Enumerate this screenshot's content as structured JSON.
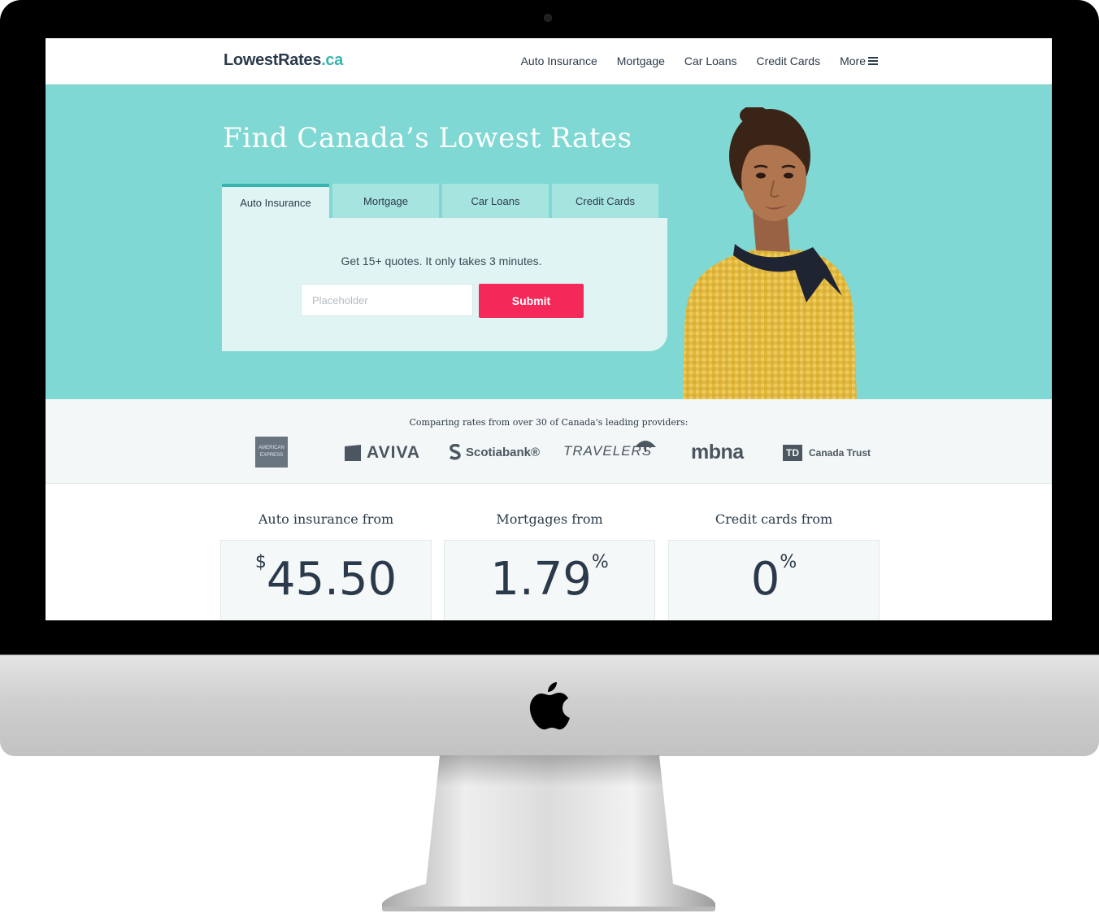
{
  "brand": {
    "name": "LowestRates",
    "tld": ".ca"
  },
  "nav": {
    "items": [
      "Auto Insurance",
      "Mortgage",
      "Car Loans",
      "Credit Cards"
    ],
    "more": "More"
  },
  "hero": {
    "title": "Find Canada’s Lowest Rates",
    "tabs": [
      {
        "label": "Auto Insurance",
        "active": true
      },
      {
        "label": "Mortgage",
        "active": false
      },
      {
        "label": "Car Loans",
        "active": false
      },
      {
        "label": "Credit Cards",
        "active": false
      }
    ],
    "tagline": "Get 15+ quotes. It only takes 3 minutes.",
    "input_placeholder": "Placeholder",
    "submit_label": "Submit"
  },
  "providers": {
    "caption": "Comparing rates from over 30 of Canada's leading providers:",
    "logos": [
      {
        "name": "American Express",
        "mark": "AMERICAN EXPRESS"
      },
      {
        "name": "Aviva",
        "mark": "AVIVA"
      },
      {
        "name": "Scotiabank",
        "mark": "Scotiabank®"
      },
      {
        "name": "Travelers",
        "mark": "TRAVELERS"
      },
      {
        "name": "MBNA",
        "mark": "mbna"
      },
      {
        "name": "TD Canada Trust",
        "mark_badge": "TD",
        "mark": "Canada Trust"
      }
    ]
  },
  "rates": [
    {
      "label": "Auto insurance from",
      "prefix": "$",
      "value": "45.50",
      "suffix": ""
    },
    {
      "label": "Mortgages from",
      "prefix": "",
      "value": "1.79",
      "suffix": "%"
    },
    {
      "label": "Credit cards from",
      "prefix": "",
      "value": "0",
      "suffix": "%"
    }
  ],
  "colors": {
    "hero_teal": "#7fd8d3",
    "tab_active": "#e0f5f3",
    "tab_inactive": "#a6e4e0",
    "accent_teal": "#36b5ae",
    "submit_pink": "#f5285a",
    "text_dark": "#2b3a4a"
  }
}
